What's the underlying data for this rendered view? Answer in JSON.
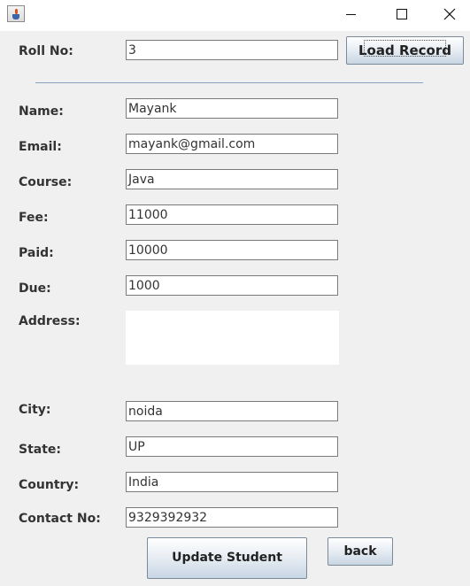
{
  "window": {
    "title": ""
  },
  "roll": {
    "label": "Roll No:",
    "value": "3",
    "load_label": "Load Record"
  },
  "fields": {
    "name": {
      "label": "Name:",
      "value": "Mayank"
    },
    "email": {
      "label": "Email:",
      "value": "mayank@gmail.com"
    },
    "course": {
      "label": "Course:",
      "value": "Java"
    },
    "fee": {
      "label": "Fee:",
      "value": "11000"
    },
    "paid": {
      "label": "Paid:",
      "value": "10000"
    },
    "due": {
      "label": "Due:",
      "value": "1000"
    },
    "address": {
      "label": "Address:",
      "value": ""
    },
    "city": {
      "label": "City:",
      "value": "noida"
    },
    "state": {
      "label": "State:",
      "value": "UP"
    },
    "country": {
      "label": "Country:",
      "value": "India"
    },
    "contact": {
      "label": "Contact No:",
      "value": "9329392932"
    }
  },
  "actions": {
    "update_label": "Update Student",
    "back_label": "back"
  },
  "icons": {
    "app": "java-cup-icon",
    "minimize": "minimize-icon",
    "maximize": "maximize-icon",
    "close": "close-icon"
  }
}
